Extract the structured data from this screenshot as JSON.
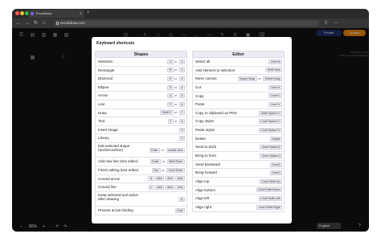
{
  "browser": {
    "tab_title": "Excalidraw",
    "url": "excalidraw.com",
    "colors": {
      "close": "#ff5f57",
      "minimize": "#febc2e",
      "zoom": "#28c840"
    }
  },
  "toolbar": {
    "private_label": "Private",
    "update_label": "Update"
  },
  "canvas_hint": {
    "line1": "Shortcuts & help",
    "line2": "Pick a tool & start drawing!"
  },
  "bottombar": {
    "zoom_minus": "−",
    "zoom_level": "80%",
    "zoom_plus": "+",
    "language": "English"
  },
  "modal": {
    "title": "Keyboard shortcuts",
    "shapes_heading": "Shapes",
    "editor_heading": "Editor",
    "shapes": [
      {
        "label": "Selection",
        "keys": [
          "V",
          "or",
          "1"
        ]
      },
      {
        "label": "Rectangle",
        "keys": [
          "R",
          "or",
          "2"
        ]
      },
      {
        "label": "Diamond",
        "keys": [
          "D",
          "or",
          "3"
        ]
      },
      {
        "label": "Ellipse",
        "keys": [
          "E",
          "or",
          "4"
        ]
      },
      {
        "label": "Arrow",
        "keys": [
          "A",
          "or",
          "5"
        ]
      },
      {
        "label": "Line",
        "keys": [
          "P",
          "or",
          "6"
        ]
      },
      {
        "label": "Draw",
        "keys": [
          "Shift+P",
          "or",
          "7"
        ]
      },
      {
        "label": "Text",
        "keys": [
          "T",
          "or",
          "8"
        ]
      },
      {
        "label": "Insert image",
        "keys": [
          "9"
        ]
      },
      {
        "label": "Library",
        "keys": [
          "0"
        ]
      },
      {
        "label": "Edit selected shape (text/arrow/line)",
        "keys": [
          "Enter",
          "or",
          "double-click"
        ]
      },
      {
        "label": "Add new line (text editor)",
        "keys": [
          "Enter",
          "or",
          "Shift+Enter"
        ]
      },
      {
        "label": "Finish editing (text editor)",
        "keys": [
          "Esc",
          "or",
          "Cmd+Enter"
        ]
      },
      {
        "label": "Curved arrow",
        "keys": [
          "A",
          "click",
          "click",
          "click"
        ]
      },
      {
        "label": "Curved line",
        "keys": [
          "L",
          "click",
          "click",
          "click"
        ]
      },
      {
        "label": "Keep selected tool active after drawing",
        "keys": [
          "Q"
        ]
      },
      {
        "label": "Prevent arrow binding",
        "keys": [
          "Cmd"
        ]
      }
    ],
    "editor": [
      {
        "label": "Select all",
        "keys": [
          "Cmd+A"
        ]
      },
      {
        "label": "Add element to selection",
        "keys": [
          "Shift+click"
        ]
      },
      {
        "label": "Move canvas",
        "keys": [
          "Space+drag",
          "or",
          "Wheel+drag"
        ]
      },
      {
        "label": "Cut",
        "keys": [
          "Cmd+X"
        ]
      },
      {
        "label": "Copy",
        "keys": [
          "Cmd+C"
        ]
      },
      {
        "label": "Paste",
        "keys": [
          "Cmd+V"
        ]
      },
      {
        "label": "Copy to clipboard as PNG",
        "keys": [
          "Shift+Option+C"
        ]
      },
      {
        "label": "Copy styles",
        "keys": [
          "Cmd+Option+C"
        ]
      },
      {
        "label": "Paste styles",
        "keys": [
          "Cmd+Option+V"
        ]
      },
      {
        "label": "Delete",
        "keys": [
          "Delete"
        ]
      },
      {
        "label": "Send to back",
        "keys": [
          "Cmd+Option+["
        ]
      },
      {
        "label": "Bring to front",
        "keys": [
          "Cmd+Option+]"
        ]
      },
      {
        "label": "Send backward",
        "keys": [
          "Cmd+["
        ]
      },
      {
        "label": "Bring forward",
        "keys": [
          "Cmd+]"
        ]
      },
      {
        "label": "Align top",
        "keys": [
          "Cmd+Shift+Up"
        ]
      },
      {
        "label": "Align bottom",
        "keys": [
          "Cmd+Shift+Down"
        ]
      },
      {
        "label": "Align left",
        "keys": [
          "Cmd+Shift+Left"
        ]
      },
      {
        "label": "Align right",
        "keys": [
          "Cmd+Shift+Right"
        ]
      }
    ]
  }
}
